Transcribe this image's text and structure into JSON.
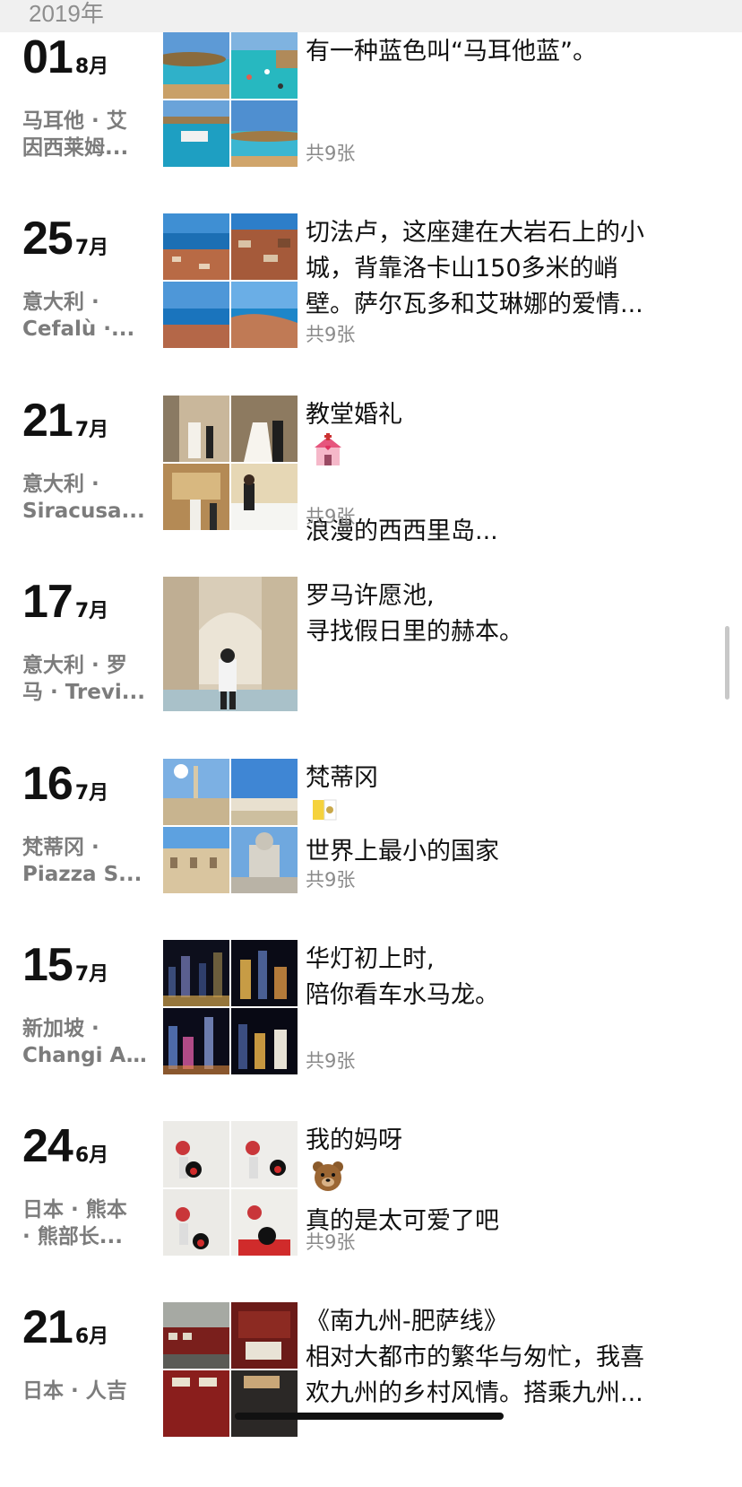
{
  "year": "2019年",
  "entries": [
    {
      "day": "01",
      "month": "8月",
      "location": [
        "马耳他 · 艾",
        "因西莱姆..."
      ],
      "caption": [
        "有一种蓝色叫“马耳他蓝”。"
      ],
      "count": "共9张"
    },
    {
      "day": "25",
      "month": "7月",
      "location": [
        "意大利 ·",
        "Cefalù ·..."
      ],
      "caption": [
        "切法卢，这座建在大岩石上的小",
        "城，背靠洛卡山150多米的峭",
        "壁。萨尔瓦多和艾琳娜的爱情..."
      ],
      "count": "共9张"
    },
    {
      "day": "21",
      "month": "7月",
      "location": [
        "意大利 ·",
        "Siracusa..."
      ],
      "caption": [
        "教堂婚礼",
        "",
        "浪漫的西西里岛..."
      ],
      "count": "共9张"
    },
    {
      "day": "17",
      "month": "7月",
      "location": [
        "意大利 · 罗",
        "马 · Trevi..."
      ],
      "caption": [
        "罗马许愿池,",
        "寻找假日里的赫本。"
      ],
      "count": ""
    },
    {
      "day": "16",
      "month": "7月",
      "location": [
        "梵蒂冈 ·",
        "Piazza S..."
      ],
      "caption": [
        "梵蒂冈",
        "世界上最小的国家"
      ],
      "count": "共9张"
    },
    {
      "day": "15",
      "month": "7月",
      "location": [
        "新加坡 ·",
        "Changi A..."
      ],
      "caption": [
        "华灯初上时,",
        "陪你看车水马龙。"
      ],
      "count": "共9张"
    },
    {
      "day": "24",
      "month": "6月",
      "location": [
        "日本 · 熊本",
        "· 熊部长..."
      ],
      "caption": [
        "我的妈呀",
        "真的是太可爱了吧"
      ],
      "count": "共9张"
    },
    {
      "day": "21",
      "month": "6月",
      "location": [
        "日本 · 人吉",
        ""
      ],
      "caption": [
        "《南九州-肥萨线》",
        "相对大都市的繁华与匆忙，我喜",
        "欢九州的乡村风情。搭乘九州..."
      ],
      "count": ""
    }
  ],
  "icons": {
    "chapel": "wedding-chapel-icon",
    "flag": "vatican-flag-icon",
    "bear": "bear-face-icon"
  }
}
